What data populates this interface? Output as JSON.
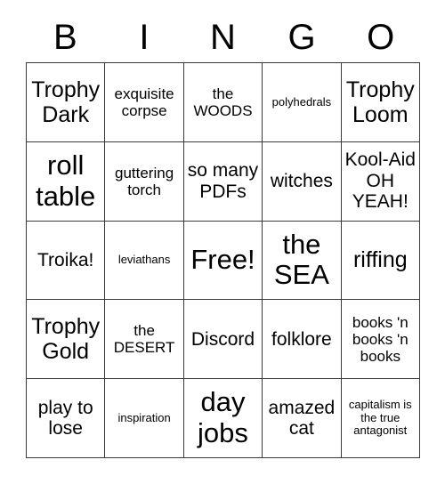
{
  "card": {
    "header_letters": [
      "B",
      "I",
      "N",
      "G",
      "O"
    ],
    "grid_size": 5,
    "colors": {
      "background": "#ffffff",
      "text": "#000000",
      "gridline": "#3a3a3a"
    },
    "cells": [
      {
        "text": "Trophy Dark",
        "size": "lg"
      },
      {
        "text": "exquisite corpse",
        "size": "sm"
      },
      {
        "text": "the WOODS",
        "size": "sm"
      },
      {
        "text": "polyhedrals",
        "size": "xs"
      },
      {
        "text": "Trophy Loom",
        "size": "lg"
      },
      {
        "text": "roll table",
        "size": "xl"
      },
      {
        "text": "guttering torch",
        "size": "sm"
      },
      {
        "text": "so many PDFs",
        "size": "md"
      },
      {
        "text": "witches",
        "size": "md"
      },
      {
        "text": "Kool-Aid OH YEAH!",
        "size": "md"
      },
      {
        "text": "Troika!",
        "size": "md"
      },
      {
        "text": "leviathans",
        "size": "xs"
      },
      {
        "text": "Free!",
        "size": "xl"
      },
      {
        "text": "the SEA",
        "size": "xl"
      },
      {
        "text": "riffing",
        "size": "lg"
      },
      {
        "text": "Trophy Gold",
        "size": "lg"
      },
      {
        "text": "the DESERT",
        "size": "sm"
      },
      {
        "text": "Discord",
        "size": "md"
      },
      {
        "text": "folklore",
        "size": "md"
      },
      {
        "text": "books 'n books 'n books",
        "size": "sm"
      },
      {
        "text": "play to lose",
        "size": "md"
      },
      {
        "text": "inspiration",
        "size": "xs"
      },
      {
        "text": "day jobs",
        "size": "xl"
      },
      {
        "text": "amazed cat",
        "size": "md"
      },
      {
        "text": "capitalism is the true antagonist",
        "size": "xs"
      }
    ]
  }
}
